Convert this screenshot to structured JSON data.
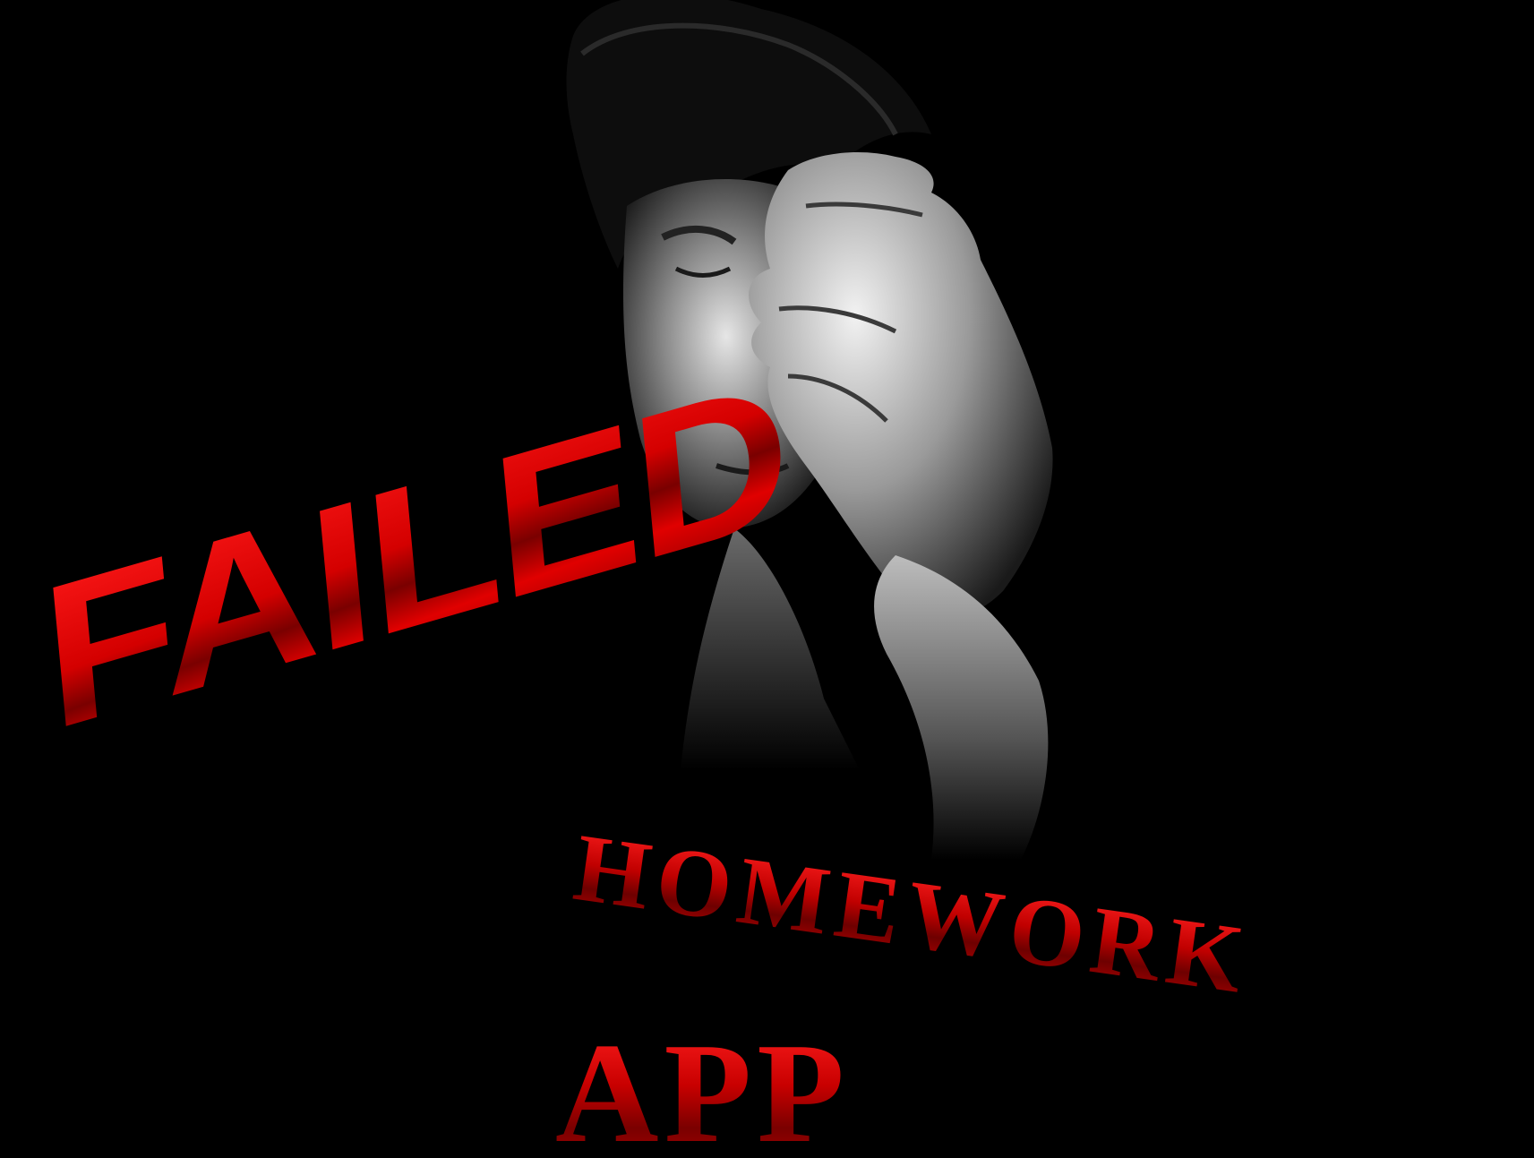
{
  "poster": {
    "headline": "FAILED",
    "subheadline": "HOMEWORK",
    "tagline": "APP"
  },
  "colors": {
    "background": "#000000",
    "text_red": "#e00000",
    "text_dark_red": "#7a0000"
  },
  "image": {
    "subject": "man-covering-face-icon"
  }
}
